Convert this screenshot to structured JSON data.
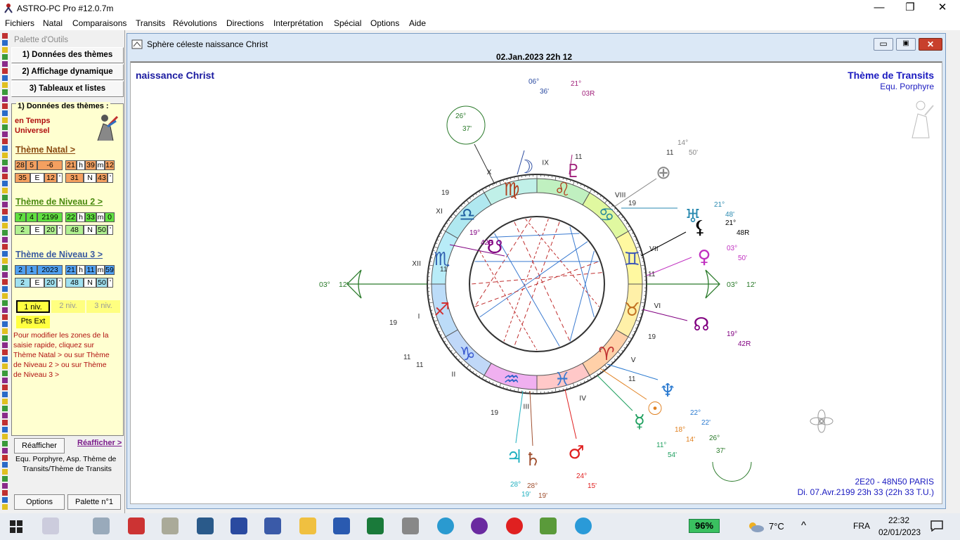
{
  "window": {
    "title": "ASTRO-PC Pro #12.0.7m",
    "minimize": "—",
    "restore": "❐",
    "close": "✕"
  },
  "menu": [
    "Fichiers",
    "Natal",
    "Comparaisons",
    "Transits",
    "Révolutions",
    "Directions",
    "Interprétation",
    "Spécial",
    "Options",
    "Aide"
  ],
  "palette": {
    "title": "Palette d'Outils",
    "buttons": [
      "1) Données des thèmes",
      "2) Affichage dynamique",
      "3) Tableaux et listes"
    ],
    "group_label": "1) Données des thèmes :",
    "time_mode": [
      "en Temps",
      "Universel"
    ],
    "natal": {
      "label": "Thème Natal >",
      "date": [
        "28",
        "5",
        "-6"
      ],
      "time": [
        "21",
        "h",
        "39",
        "m",
        "12"
      ],
      "lon": [
        "35",
        "E",
        "12",
        "'"
      ],
      "lat": [
        "31",
        "N",
        "43",
        "'"
      ]
    },
    "level2": {
      "label": "Thème de Niveau 2 >",
      "date": [
        "7",
        "4",
        "2199"
      ],
      "time": [
        "22",
        "h",
        "33",
        "m",
        "0"
      ],
      "lon": [
        "2",
        "E",
        "20",
        "'"
      ],
      "lat": [
        "48",
        "N",
        "50",
        "'"
      ]
    },
    "level3": {
      "label": "Thème de Niveau 3 >",
      "date": [
        "2",
        "1",
        "2023"
      ],
      "time": [
        "21",
        "h",
        "11",
        "m",
        "59"
      ],
      "lon": [
        "2",
        "E",
        "20",
        "'"
      ],
      "lat": [
        "48",
        "N",
        "50",
        "'"
      ]
    },
    "level_buttons": [
      "1 niv.",
      "2 niv.",
      "3 niv."
    ],
    "pts_ext": "Pts Ext",
    "help": [
      "Pour modifier les zones de la",
      "saisie rapide, cliquez sur",
      "Thème Natal > ou sur Thème",
      "de Niveau 2 > ou sur Thème",
      "de Niveau 3 >"
    ],
    "redisplay_btn": "Réafficher",
    "redisplay_link": "Réafficher >",
    "info": [
      "Equ. Porphyre, Asp. Thème de",
      "Transits/Thème de Transits"
    ],
    "options_btn": "Options",
    "palette_btn": "Palette n°1"
  },
  "child": {
    "title": "Sphère céleste  naissance Christ",
    "header_date": "02.Jan.2023 22h 12",
    "left_title": "naissance Christ",
    "right_title": "Thème de Transits",
    "right_sub": "Equ. Porphyre",
    "loc": "2E20 - 48N50  PARIS",
    "date": "Di. 07.Avr.2199 23h 33 (22h 33 T.U.)"
  },
  "chart": {
    "houses": [
      "I",
      "II",
      "III",
      "IV",
      "V",
      "VI",
      "VII",
      "VIII",
      "IX",
      "X",
      "XI",
      "XII"
    ],
    "signs": [
      "♐",
      "♑",
      "♒",
      "♓",
      "♈",
      "♉",
      "♊",
      "♋",
      "♌",
      "♍",
      "♎",
      "♏"
    ],
    "sign_colors": [
      "#d23030",
      "#3b5bd0",
      "#2a63c8",
      "#3b7ad0",
      "#c03030",
      "#c07020",
      "#3a56b8",
      "#2a8a9a",
      "#b04020",
      "#b04020",
      "#2060a0",
      "#3060b0"
    ],
    "planet_labels": [
      {
        "glyph": "☽",
        "deg": "06°",
        "min": "36'",
        "color": "#2a4aa0"
      },
      {
        "glyph": "♇",
        "deg": "21°",
        "min": "03R",
        "color": "#a0207a"
      },
      {
        "glyph": "♅",
        "deg": "21°",
        "min": "48'",
        "color": "#2a8ab0"
      },
      {
        "glyph": "♀",
        "deg": "03°",
        "min": "50'",
        "color": "#c030c0"
      },
      {
        "glyph": "☋",
        "deg": "19°",
        "min": "42R",
        "color": "#800080"
      },
      {
        "glyph": "♆",
        "deg": "22°",
        "min": "22'",
        "color": "#2a7ad0"
      },
      {
        "glyph": "☉",
        "deg": "18°",
        "min": "14'",
        "color": "#e08020"
      },
      {
        "glyph": "☿",
        "deg": "11°",
        "min": "54'",
        "color": "#20a060"
      },
      {
        "glyph": "♂",
        "deg": "24°",
        "min": "15'",
        "color": "#e02020"
      },
      {
        "glyph": "♄",
        "deg": "28°",
        "min": "19'",
        "color": "#a05030"
      },
      {
        "glyph": "♃",
        "deg": "28°",
        "min": "19'",
        "color": "#20b0c0"
      },
      {
        "glyph": "☊",
        "deg": "19°",
        "min": "42R",
        "color": "#800080"
      },
      {
        "glyph": "⚸",
        "deg": "21°",
        "min": "48R",
        "color": "#000"
      },
      {
        "glyph": "⊕",
        "deg": "14°",
        "min": "50'",
        "color": "#888"
      }
    ],
    "asc": {
      "deg": "03°",
      "min": "12'"
    },
    "mc": {
      "deg": "26°",
      "min": "37'"
    },
    "cusp_small": [
      "19",
      "11",
      "19",
      "11",
      "19",
      "11",
      "19",
      "11",
      "19",
      "11",
      "11",
      "11"
    ]
  },
  "taskbar": {
    "battery": "96%",
    "temp": "7°C",
    "lang": "FRA",
    "time": "22:32",
    "date": "02/01/2023"
  }
}
